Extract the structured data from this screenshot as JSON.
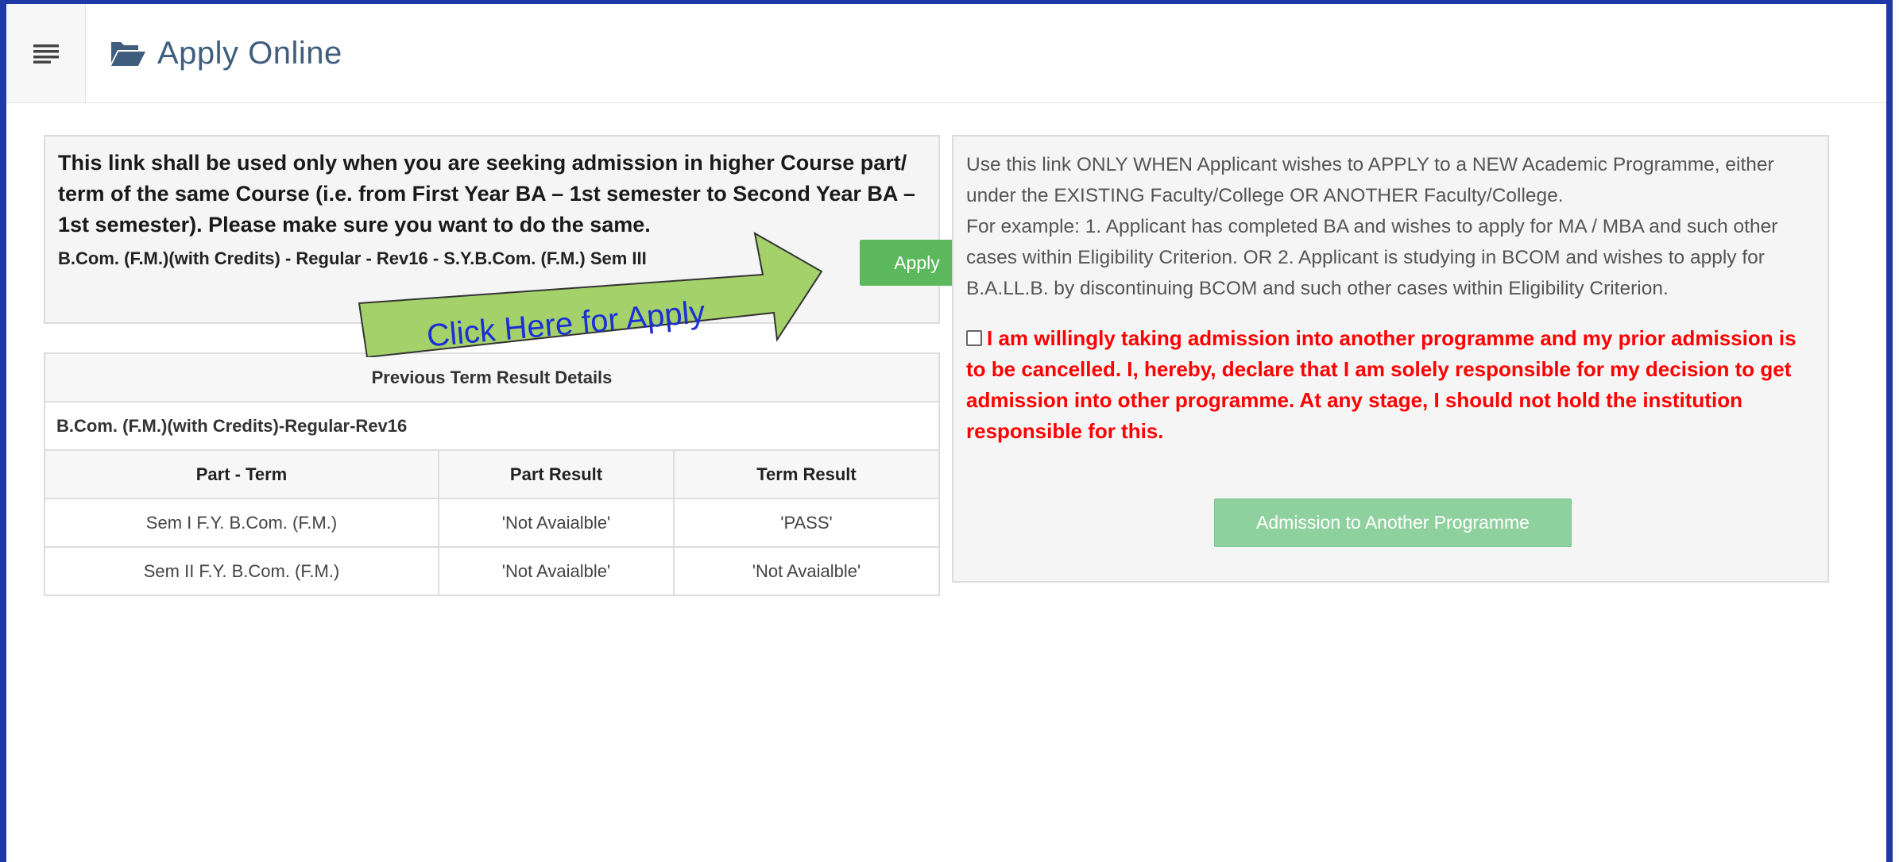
{
  "header": {
    "title": "Apply Online",
    "menu_icon": "hamburger-icon",
    "title_icon": "folder-open-icon"
  },
  "left_panel": {
    "notice": "This link shall be used only when you are seeking admission in higher Course part/ term of the same Course (i.e. from First Year BA – 1st semester to Second Year BA – 1st semester). Please make sure you want to do the same.",
    "course_line": "B.Com. (F.M.)(with Credits) - Regular - Rev16 - S.Y.B.Com. (F.M.) Sem III",
    "apply_label": "Apply"
  },
  "callout": {
    "text": "Click Here for Apply",
    "color": "#a4d16a"
  },
  "results": {
    "caption": "Previous Term Result Details",
    "course": "B.Com. (F.M.)(with Credits)-Regular-Rev16",
    "columns": [
      "Part - Term",
      "Part Result",
      "Term Result"
    ],
    "rows": [
      [
        "Sem I F.Y. B.Com. (F.M.)",
        "'Not Avaialble'",
        "'PASS'"
      ],
      [
        "Sem II F.Y. B.Com. (F.M.)",
        "'Not Avaialble'",
        "'Not Avaialble'"
      ]
    ]
  },
  "right_panel": {
    "info_line1": "Use this link ONLY WHEN Applicant wishes to APPLY to a NEW Academic Programme, either under the EXISTING Faculty/College OR ANOTHER Faculty/College.",
    "info_line2": "For example: 1. Applicant has completed BA and wishes to apply for MA / MBA and such other cases within Eligibility Criterion. OR 2. Applicant is studying in BCOM and wishes to apply for B.A.LL.B. by discontinuing BCOM and such other cases within Eligibility Criterion.",
    "declaration": "I am willingly taking admission into another programme and my prior admission is to be cancelled. I, hereby, declare that I am solely responsible for my decision to get admission into other programme. At any stage, I should not hold the institution responsible for this.",
    "declaration_checked": false,
    "admission_button": "Admission to Another Programme"
  },
  "colors": {
    "frame": "#1f3aa8",
    "apply_button": "#5cb85c",
    "admission_button": "#8fd19e",
    "declaration": "#ff0000",
    "title": "#3f5d7d",
    "callout_text": "#1a2fd6"
  }
}
